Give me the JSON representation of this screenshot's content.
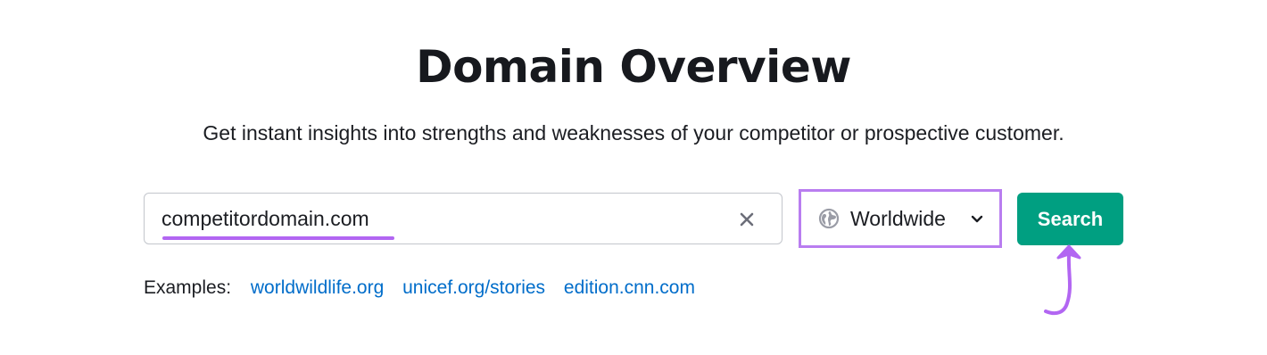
{
  "page": {
    "title": "Domain Overview",
    "subtitle": "Get instant insights into strengths and weaknesses of your competitor or prospective customer."
  },
  "search": {
    "value": "competitordomain.com",
    "clear_icon": "close-icon"
  },
  "region": {
    "selected": "Worldwide",
    "icon": "globe-icon",
    "dropdown_icon": "chevron-down-icon"
  },
  "search_button": {
    "label": "Search"
  },
  "examples": {
    "label": "Examples:",
    "links": [
      "worldwildlife.org",
      "unicef.org/stories",
      "edition.cnn.com"
    ]
  },
  "colors": {
    "primary_button": "#009f81",
    "link": "#006dca",
    "highlight": "#b266f2",
    "input_border": "#c3c6cc",
    "text": "#1b1d22"
  }
}
